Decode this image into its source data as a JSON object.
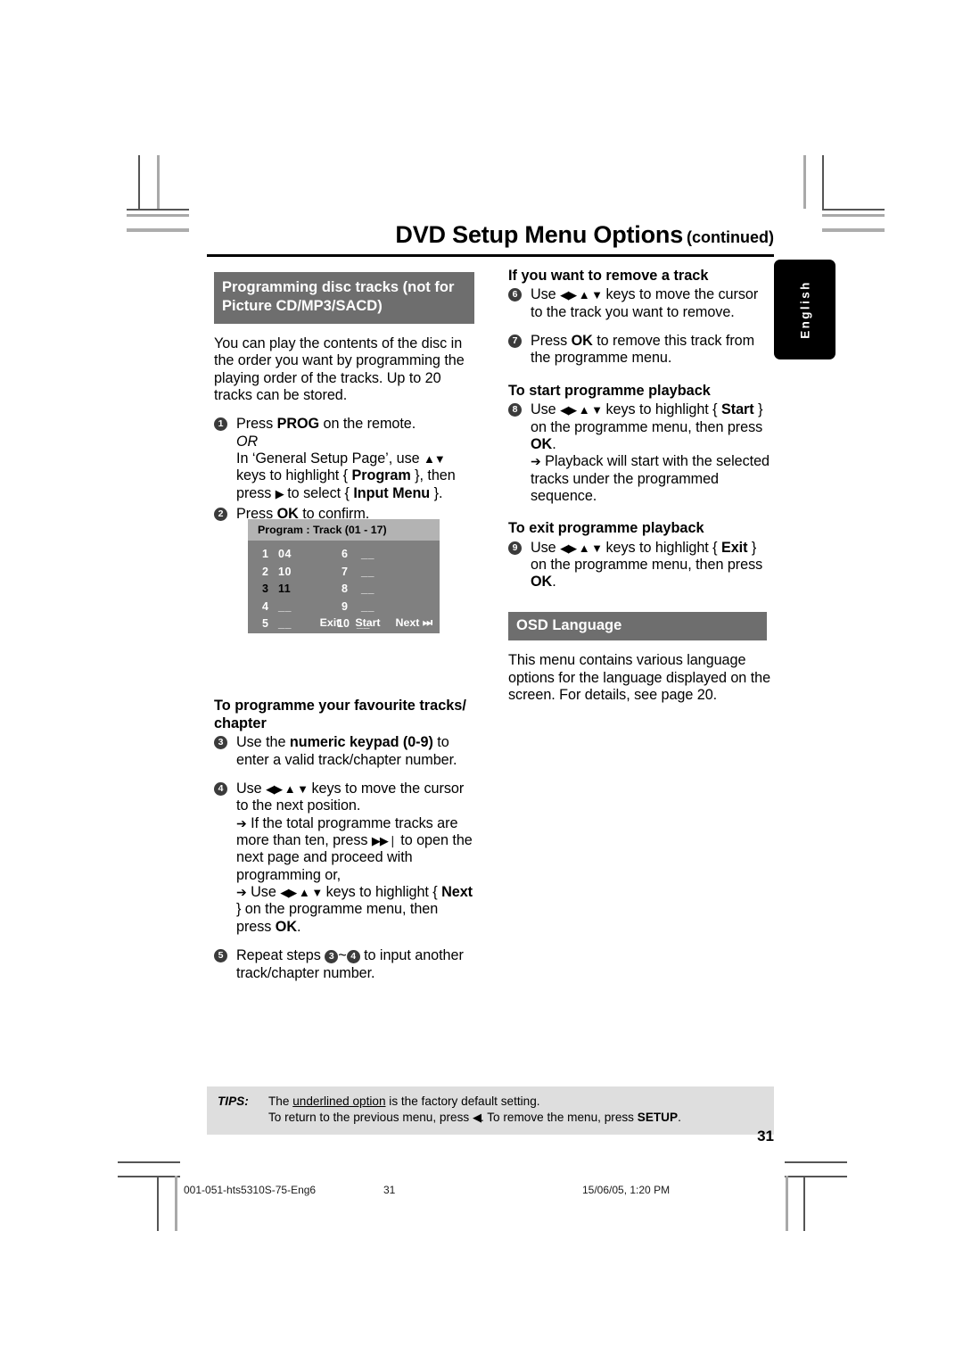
{
  "header": {
    "title": "DVD Setup Menu Options",
    "continued": "(continued)"
  },
  "language_tab": {
    "label": "English"
  },
  "left_column": {
    "section_title": "Programming disc tracks (not for Picture CD/MP3/SACD)",
    "intro": "You can play the contents of the disc in the order you want by programming the playing order of the tracks. Up to 20 tracks can be stored.",
    "step1": {
      "number": "1",
      "line1_pre": "Press ",
      "line1_key": "PROG",
      "line1_post": " on the remote.",
      "or": "OR",
      "line2_a": "In ‘General Setup Page’, use ",
      "line2_keys": "▲▼",
      "line2_b": " keys to highlight { ",
      "line2_prog": "Program",
      "line2_c": " }, then press ",
      "line2_arrow": "▶",
      "line2_d": " to select { ",
      "line2_input": "Input Menu",
      "line2_e": " }."
    },
    "step2": {
      "number": "2",
      "pre": "Press ",
      "key": "OK",
      "post": " to confirm."
    },
    "subhead_favourite": "To programme your favourite tracks/ chapter",
    "step3": {
      "number": "3",
      "pre": "Use the ",
      "key": "numeric keypad (0-9)",
      "post": " to enter a valid track/chapter number."
    },
    "step4": {
      "number": "4",
      "a": "Use ",
      "keys": "◀▶ ▲ ▼",
      "b": " keys to move the cursor to the next position.",
      "bullet1_arrow": "➔",
      "bullet1_a": " If the total programme tracks are more than ten, press ",
      "bullet1_key": "▶▶❘",
      "bullet1_b": " to open the next page and proceed with programming or,",
      "bullet2_arrow": "➔",
      "bullet2_a": " Use ",
      "bullet2_keys": "◀▶ ▲ ▼",
      "bullet2_b": " keys to highlight { ",
      "bullet2_next": "Next",
      "bullet2_c": " } on the programme menu, then press ",
      "bullet2_ok": "OK",
      "bullet2_d": "."
    },
    "step5": {
      "number": "5",
      "a": "Repeat steps ",
      "ref1": "3",
      "tilde": "~",
      "ref2": "4",
      "b": " to input another track/chapter number."
    }
  },
  "program_box": {
    "title": "Program : Track (01 - 17)",
    "entries_left": [
      {
        "index": "1",
        "value": "04",
        "cursor": false
      },
      {
        "index": "2",
        "value": "10",
        "cursor": false
      },
      {
        "index": "3",
        "value": "11",
        "cursor": true
      },
      {
        "index": "4",
        "value": "__",
        "cursor": false
      },
      {
        "index": "5",
        "value": "__",
        "cursor": false
      }
    ],
    "entries_right": [
      {
        "index": "6",
        "value": "__",
        "cursor": false
      },
      {
        "index": "7",
        "value": "__",
        "cursor": false
      },
      {
        "index": "8",
        "value": "__",
        "cursor": false
      },
      {
        "index": "9",
        "value": "__",
        "cursor": false
      },
      {
        "index": "10",
        "value": "__",
        "cursor": false
      }
    ],
    "buttons": {
      "exit": "Exit",
      "start": "Start",
      "next": "Next ⏭"
    }
  },
  "right_column": {
    "subhead_remove": "If you want to remove a track",
    "step6": {
      "number": "6",
      "a": "Use ",
      "keys": "◀▶ ▲ ▼",
      "b": " keys to move the cursor to the track you want to remove."
    },
    "step7": {
      "number": "7",
      "a": "Press ",
      "key": "OK",
      "b": " to remove this track from the programme menu."
    },
    "subhead_start": "To start programme playback",
    "step8": {
      "number": "8",
      "a": "Use ",
      "keys": "◀▶ ▲ ▼",
      "b": " keys to highlight { ",
      "start": "Start",
      "c": " } on the programme menu, then press ",
      "ok": "OK",
      "d": ".",
      "bullet_arrow": "➔",
      "bullet": " Playback will start with the selected tracks under the programmed sequence."
    },
    "subhead_exit": "To exit programme playback",
    "step9": {
      "number": "9",
      "a": "Use ",
      "keys": "◀▶ ▲ ▼",
      "b": " keys to highlight { ",
      "exit": "Exit",
      "c": " } on the programme menu, then press ",
      "ok": "OK",
      "d": "."
    },
    "osd_section_title": "OSD Language",
    "osd_body": "This menu contains various language options for the language displayed on the screen.  For details, see page 20."
  },
  "tips": {
    "label": "TIPS:",
    "line1_pre": "The ",
    "line1_underlined": "underlined option",
    "line1_post": " is the factory default setting.",
    "line2_a": "To return to the previous menu, press ",
    "line2_key": "◀",
    "line2_b": ". To remove the menu, press ",
    "line2_setup": "SETUP",
    "line2_c": "."
  },
  "page_number": "31",
  "print_footer": {
    "filename": "001-051-hts5310S-75-Eng6",
    "page": "31",
    "timestamp": "15/06/05, 1:20 PM"
  }
}
